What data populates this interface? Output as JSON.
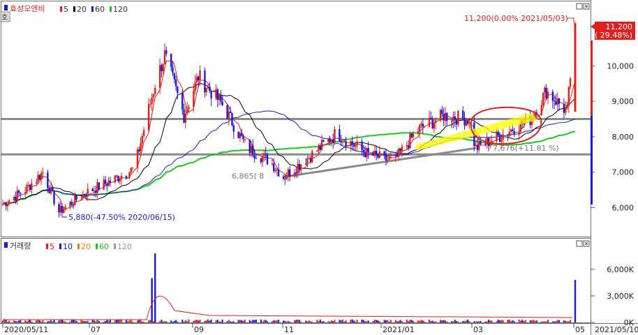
{
  "window": {
    "corner_button": "호"
  },
  "price_panel": {
    "stock_name": "효성오앤비",
    "ma_legend": [
      {
        "label": "5",
        "color": "#e0201c"
      },
      {
        "label": "20",
        "color": "#000000"
      },
      {
        "label": "60",
        "color": "#1a1adc"
      },
      {
        "label": "120",
        "color": "#1fc51f"
      }
    ],
    "y_ticks": [
      "10,000",
      "9,000",
      "8,000",
      "7,000",
      "6,000"
    ],
    "current_price_box": {
      "price": "11,200",
      "change": "( 29.48%)"
    },
    "annotations": {
      "high": "11,200(0.00% 2021/05/03)",
      "low": "5,880(-47.50% 2020/06/15)",
      "mid_low": "6,865(  8",
      "mid_recent": "7,676(+11.81 %)"
    }
  },
  "volume_panel": {
    "title": "거래량",
    "ma_legend": [
      {
        "label": "5",
        "color": "#e0201c"
      },
      {
        "label": "10",
        "color": "#1a1adc"
      },
      {
        "label": "20",
        "color": "#e08a00"
      },
      {
        "label": "60",
        "color": "#1fc51f"
      },
      {
        "label": "120",
        "color": "#9a9a9a"
      }
    ],
    "y_ticks": [
      "6,000K",
      "3,000K",
      "0K"
    ]
  },
  "x_axis": {
    "labels": [
      "2020/05/11",
      "07",
      "09",
      "11",
      "2021/01",
      "03",
      "05",
      "2021/05/10"
    ]
  },
  "colors": {
    "up": "#e0201c",
    "down": "#1a1adc",
    "ma5": "#e0201c",
    "ma20": "#000000",
    "ma60": "#1a1adc",
    "ma120": "#1fc51f",
    "support": "#888888"
  },
  "chart_data": {
    "type": "candlestick",
    "title": "효성오앤비",
    "x_range": [
      "2020-05-11",
      "2021-05-10"
    ],
    "ylim": [
      5200,
      11700
    ],
    "key_points": [
      {
        "date": "2020-06-15",
        "price": 5880,
        "label": "low"
      },
      {
        "date": "2020-08-17",
        "price": 10400,
        "label": "spike"
      },
      {
        "date": "2020-11-02",
        "price": 6865,
        "label": "mid low"
      },
      {
        "date": "2021-03-02",
        "price": 7676,
        "label": "recent low"
      },
      {
        "date": "2021-05-03",
        "price": 11200,
        "label": "high"
      }
    ],
    "close_series": [
      {
        "date": "2020-05-11",
        "close": 6100
      },
      {
        "date": "2020-05-25",
        "close": 6500
      },
      {
        "date": "2020-06-05",
        "close": 7000
      },
      {
        "date": "2020-06-15",
        "close": 5880
      },
      {
        "date": "2020-07-01",
        "close": 6400
      },
      {
        "date": "2020-07-15",
        "close": 6700
      },
      {
        "date": "2020-08-01",
        "close": 7100
      },
      {
        "date": "2020-08-14",
        "close": 9500
      },
      {
        "date": "2020-08-20",
        "close": 10300
      },
      {
        "date": "2020-09-01",
        "close": 8600
      },
      {
        "date": "2020-09-10",
        "close": 9700
      },
      {
        "date": "2020-09-25",
        "close": 8900
      },
      {
        "date": "2020-10-10",
        "close": 7700
      },
      {
        "date": "2020-10-25",
        "close": 7300
      },
      {
        "date": "2020-11-02",
        "close": 6865
      },
      {
        "date": "2020-11-20",
        "close": 7500
      },
      {
        "date": "2020-12-05",
        "close": 8100
      },
      {
        "date": "2020-12-25",
        "close": 7500
      },
      {
        "date": "2021-01-10",
        "close": 7300
      },
      {
        "date": "2021-01-25",
        "close": 8200
      },
      {
        "date": "2021-02-10",
        "close": 8600
      },
      {
        "date": "2021-02-25",
        "close": 8500
      },
      {
        "date": "2021-03-02",
        "close": 7676
      },
      {
        "date": "2021-03-20",
        "close": 8100
      },
      {
        "date": "2021-04-05",
        "close": 8500
      },
      {
        "date": "2021-04-15",
        "close": 9300
      },
      {
        "date": "2021-04-28",
        "close": 8700
      },
      {
        "date": "2021-05-03",
        "close": 11200
      }
    ],
    "current": {
      "price": 11200,
      "change_pct": 29.48
    },
    "horizontal_lines": [
      8500,
      7500
    ],
    "volume_ylim": [
      0,
      8200
    ],
    "volume_unit": "K",
    "volume_spikes": [
      {
        "date": "2020-08-14",
        "volume": 7800
      },
      {
        "date": "2020-08-12",
        "volume": 5000
      },
      {
        "date": "2021-05-03",
        "volume": 4800
      }
    ]
  }
}
